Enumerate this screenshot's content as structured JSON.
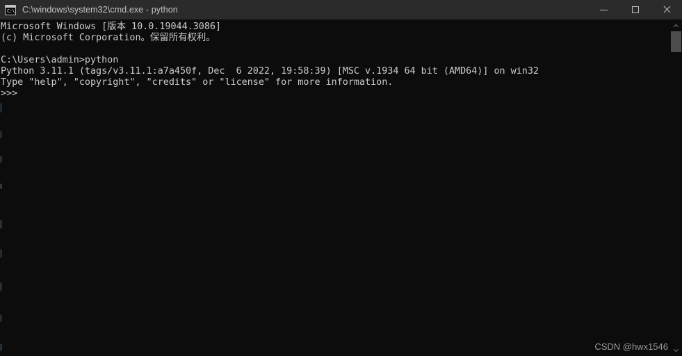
{
  "window": {
    "title": "C:\\windows\\system32\\cmd.exe - python",
    "icon_name": "cmd-exe-icon",
    "icon_glyph": "C:\\",
    "controls": {
      "minimize_label": "Minimize",
      "maximize_label": "Maximize",
      "close_label": "Close"
    },
    "colors": {
      "titlebar_bg": "#2b2b2b",
      "console_bg": "#0c0c0c",
      "console_fg": "#cccccc",
      "title_fg": "#c3c3c3",
      "scrollbar_thumb": "#4d4d4d"
    }
  },
  "console": {
    "lines": [
      "Microsoft Windows [版本 10.0.19044.3086]",
      "(c) Microsoft Corporation。保留所有权利。",
      "",
      "C:\\Users\\admin>python",
      "Python 3.11.1 (tags/v3.11.1:a7a450f, Dec  6 2022, 19:58:39) [MSC v.1934 64 bit (AMD64)] on win32",
      "Type \"help\", \"copyright\", \"credits\" or \"license\" for more information.",
      ">>>"
    ],
    "text": "Microsoft Windows [版本 10.0.19044.3086]\n(c) Microsoft Corporation。保留所有权利。\n\nC:\\Users\\admin>python\nPython 3.11.1 (tags/v3.11.1:a7a450f, Dec  6 2022, 19:58:39) [MSC v.1934 64 bit (AMD64)] on win32\nType \"help\", \"copyright\", \"credits\" or \"license\" for more information.\n>>>"
  },
  "scrollbar": {
    "up_arrow_name": "scroll-up-arrow",
    "down_arrow_name": "scroll-down-arrow"
  },
  "watermark": {
    "text": "CSDN @hwx1546"
  }
}
